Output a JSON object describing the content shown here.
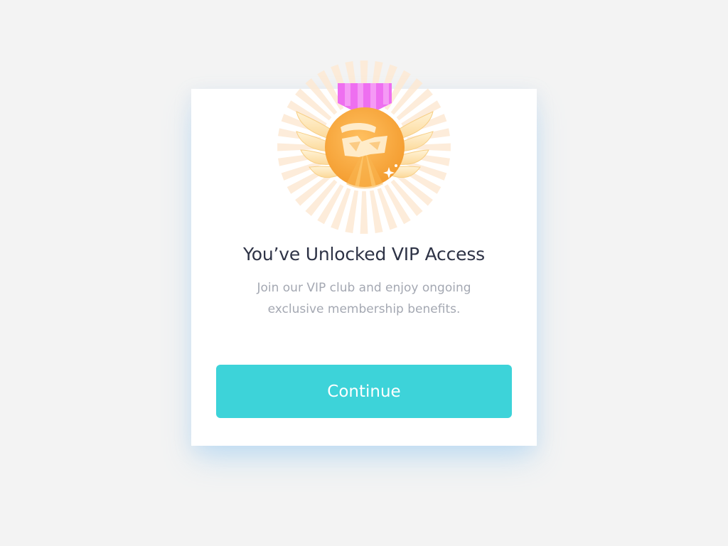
{
  "dialog": {
    "title": "You’ve Unlocked VIP Access",
    "description_line1": "Join our VIP club and enjoy ongoing",
    "description_line2": "exclusive membership benefits.",
    "continue_label": "Continue"
  },
  "badge": {
    "icon": "vip-medal-icon",
    "ribbon_color": "#ee6ff0",
    "medal_color": "#f7a83b",
    "wing_color": "#fde5b5",
    "ray_color": "#fde9d4"
  },
  "colors": {
    "background": "#f3f3f3",
    "card": "#ffffff",
    "accent": "#3dd3d9",
    "title": "#2e3346",
    "subtitle": "#a4a8b2"
  }
}
